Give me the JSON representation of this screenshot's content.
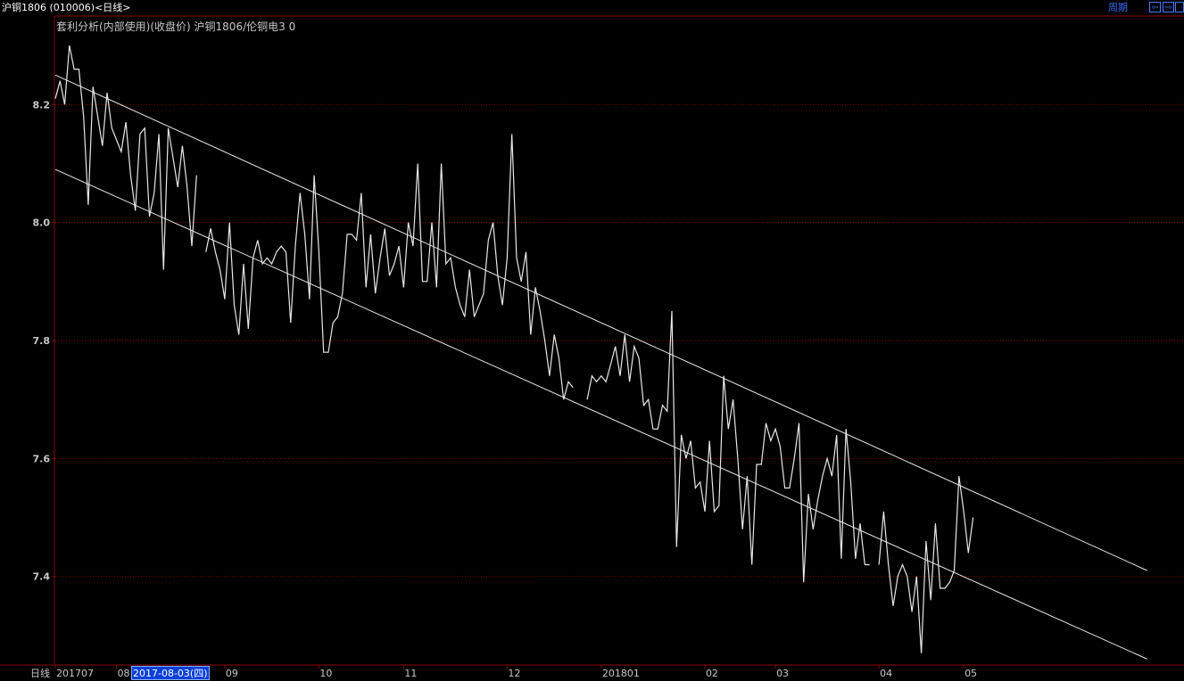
{
  "window": {
    "title": "沪铜1806 (010006)<日线>",
    "period_label": "周期",
    "nav_left_icon": "left-arrow-icon",
    "nav_right_icon": "right-arrow-icon",
    "nav_left_glyph": "⇦",
    "nav_right_glyph": "⇨"
  },
  "colors": {
    "background": "#000000",
    "line": "#e8e8e8",
    "grid": "#8b0000",
    "axis": "#8b0000",
    "label": "#c8c8c8",
    "cursor_bg": "#0a3fd8"
  },
  "chart_data": {
    "type": "line",
    "title": "套利分析(内部使用)(收盘价) 沪铜1806/伦铜电3  0",
    "timeframe_label": "日线",
    "ylim": [
      7.25,
      8.35
    ],
    "yticks": [
      7.4,
      7.6,
      7.8,
      8.0,
      8.2
    ],
    "ytick_labels": [
      "7.4",
      "7.6",
      "7.8",
      "8.0",
      "8.2"
    ],
    "grid": "horizontal dotted",
    "x_index_range": [
      0,
      232
    ],
    "xticks": [
      {
        "label": "201707",
        "index": 0
      },
      {
        "label": "08",
        "index": 13
      },
      {
        "label": "09",
        "index": 36
      },
      {
        "label": "10",
        "index": 56
      },
      {
        "label": "11",
        "index": 74
      },
      {
        "label": "12",
        "index": 96
      },
      {
        "label": "201801",
        "index": 116
      },
      {
        "label": "02",
        "index": 138
      },
      {
        "label": "03",
        "index": 153
      },
      {
        "label": "04",
        "index": 175
      },
      {
        "label": "05",
        "index": 193
      }
    ],
    "cursor_date": "2017-08-03(四)",
    "segments": [
      [
        [
          0,
          8.21
        ],
        [
          1,
          8.24
        ],
        [
          2,
          8.2
        ],
        [
          3,
          8.3
        ],
        [
          4,
          8.26
        ],
        [
          5,
          8.26
        ],
        [
          6,
          8.18
        ],
        [
          7,
          8.03
        ],
        [
          8,
          8.23
        ],
        [
          9,
          8.18
        ],
        [
          10,
          8.13
        ],
        [
          11,
          8.22
        ],
        [
          12,
          8.16
        ],
        [
          13,
          8.14
        ],
        [
          14,
          8.12
        ],
        [
          15,
          8.17
        ],
        [
          16,
          8.08
        ],
        [
          17,
          8.02
        ],
        [
          18,
          8.15
        ],
        [
          19,
          8.16
        ],
        [
          20,
          8.01
        ],
        [
          21,
          8.05
        ],
        [
          22,
          8.15
        ],
        [
          23,
          7.92
        ],
        [
          24,
          8.16
        ],
        [
          25,
          8.11
        ],
        [
          26,
          8.06
        ],
        [
          27,
          8.13
        ],
        [
          28,
          8.06
        ],
        [
          29,
          7.96
        ],
        [
          30,
          8.08
        ]
      ],
      [
        [
          32,
          7.95
        ],
        [
          33,
          7.99
        ],
        [
          34,
          7.95
        ],
        [
          35,
          7.92
        ],
        [
          36,
          7.87
        ],
        [
          37,
          8.0
        ],
        [
          38,
          7.86
        ],
        [
          39,
          7.81
        ],
        [
          40,
          7.93
        ],
        [
          41,
          7.82
        ],
        [
          42,
          7.94
        ],
        [
          43,
          7.97
        ],
        [
          44,
          7.93
        ],
        [
          45,
          7.94
        ],
        [
          46,
          7.93
        ],
        [
          47,
          7.95
        ],
        [
          48,
          7.96
        ],
        [
          49,
          7.95
        ],
        [
          50,
          7.83
        ],
        [
          51,
          7.96
        ],
        [
          52,
          8.05
        ],
        [
          53,
          7.98
        ],
        [
          54,
          7.87
        ],
        [
          55,
          8.08
        ],
        [
          56,
          7.95
        ],
        [
          57,
          7.78
        ],
        [
          58,
          7.78
        ],
        [
          59,
          7.83
        ],
        [
          60,
          7.84
        ],
        [
          61,
          7.88
        ],
        [
          62,
          7.98
        ],
        [
          63,
          7.98
        ],
        [
          64,
          7.97
        ],
        [
          65,
          8.05
        ],
        [
          66,
          7.89
        ],
        [
          67,
          7.98
        ],
        [
          68,
          7.88
        ],
        [
          69,
          7.94
        ],
        [
          70,
          7.99
        ],
        [
          71,
          7.91
        ],
        [
          72,
          7.93
        ],
        [
          73,
          7.96
        ],
        [
          74,
          7.89
        ],
        [
          75,
          8.0
        ],
        [
          76,
          7.96
        ],
        [
          77,
          8.1
        ],
        [
          78,
          7.9
        ],
        [
          79,
          7.9
        ],
        [
          80,
          8.0
        ],
        [
          81,
          7.89
        ],
        [
          82,
          8.1
        ],
        [
          83,
          7.93
        ],
        [
          84,
          7.94
        ],
        [
          85,
          7.89
        ],
        [
          86,
          7.86
        ],
        [
          87,
          7.84
        ],
        [
          88,
          7.92
        ],
        [
          89,
          7.84
        ],
        [
          90,
          7.86
        ],
        [
          91,
          7.88
        ],
        [
          92,
          7.97
        ],
        [
          93,
          8.0
        ],
        [
          94,
          7.91
        ],
        [
          95,
          7.86
        ],
        [
          96,
          7.94
        ],
        [
          97,
          8.15
        ],
        [
          98,
          7.94
        ],
        [
          99,
          7.9
        ],
        [
          100,
          7.95
        ],
        [
          101,
          7.81
        ],
        [
          102,
          7.89
        ],
        [
          103,
          7.85
        ],
        [
          104,
          7.8
        ],
        [
          105,
          7.74
        ],
        [
          106,
          7.81
        ],
        [
          107,
          7.77
        ],
        [
          108,
          7.7
        ],
        [
          109,
          7.73
        ],
        [
          110,
          7.72
        ]
      ],
      [
        [
          113,
          7.7
        ],
        [
          114,
          7.74
        ],
        [
          115,
          7.73
        ],
        [
          116,
          7.74
        ],
        [
          117,
          7.73
        ],
        [
          118,
          7.76
        ],
        [
          119,
          7.79
        ],
        [
          120,
          7.74
        ],
        [
          121,
          7.81
        ],
        [
          122,
          7.73
        ],
        [
          123,
          7.79
        ],
        [
          124,
          7.77
        ],
        [
          125,
          7.69
        ],
        [
          126,
          7.7
        ],
        [
          127,
          7.65
        ],
        [
          128,
          7.65
        ],
        [
          129,
          7.69
        ],
        [
          130,
          7.68
        ],
        [
          131,
          7.85
        ],
        [
          132,
          7.45
        ],
        [
          133,
          7.64
        ],
        [
          134,
          7.6
        ],
        [
          135,
          7.63
        ],
        [
          136,
          7.55
        ],
        [
          137,
          7.56
        ],
        [
          138,
          7.51
        ],
        [
          139,
          7.63
        ],
        [
          140,
          7.51
        ],
        [
          141,
          7.52
        ],
        [
          142,
          7.74
        ],
        [
          143,
          7.65
        ],
        [
          144,
          7.7
        ],
        [
          145,
          7.6
        ],
        [
          146,
          7.48
        ],
        [
          147,
          7.57
        ],
        [
          148,
          7.42
        ],
        [
          149,
          7.59
        ],
        [
          150,
          7.59
        ],
        [
          151,
          7.66
        ],
        [
          152,
          7.63
        ],
        [
          153,
          7.65
        ],
        [
          154,
          7.62
        ],
        [
          155,
          7.55
        ],
        [
          156,
          7.55
        ],
        [
          157,
          7.6
        ],
        [
          158,
          7.66
        ],
        [
          159,
          7.39
        ],
        [
          160,
          7.54
        ],
        [
          161,
          7.48
        ],
        [
          162,
          7.53
        ],
        [
          163,
          7.57
        ],
        [
          164,
          7.6
        ],
        [
          165,
          7.57
        ],
        [
          166,
          7.64
        ],
        [
          167,
          7.43
        ],
        [
          168,
          7.65
        ],
        [
          169,
          7.56
        ],
        [
          170,
          7.43
        ],
        [
          171,
          7.49
        ],
        [
          172,
          7.42
        ],
        [
          173,
          7.42
        ]
      ],
      [
        [
          175,
          7.42
        ],
        [
          176,
          7.51
        ],
        [
          177,
          7.42
        ],
        [
          178,
          7.35
        ],
        [
          179,
          7.4
        ],
        [
          180,
          7.42
        ],
        [
          181,
          7.4
        ],
        [
          182,
          7.34
        ],
        [
          183,
          7.4
        ],
        [
          184,
          7.27
        ],
        [
          185,
          7.46
        ],
        [
          186,
          7.36
        ],
        [
          187,
          7.49
        ],
        [
          188,
          7.38
        ],
        [
          189,
          7.38
        ],
        [
          190,
          7.39
        ],
        [
          191,
          7.41
        ],
        [
          192,
          7.57
        ],
        [
          193,
          7.51
        ],
        [
          194,
          7.44
        ],
        [
          195,
          7.5
        ]
      ]
    ],
    "trend_channel": {
      "upper": [
        [
          0,
          8.25
        ],
        [
          232,
          7.41
        ]
      ],
      "lower": [
        [
          0,
          8.09
        ],
        [
          232,
          7.26
        ]
      ]
    }
  }
}
